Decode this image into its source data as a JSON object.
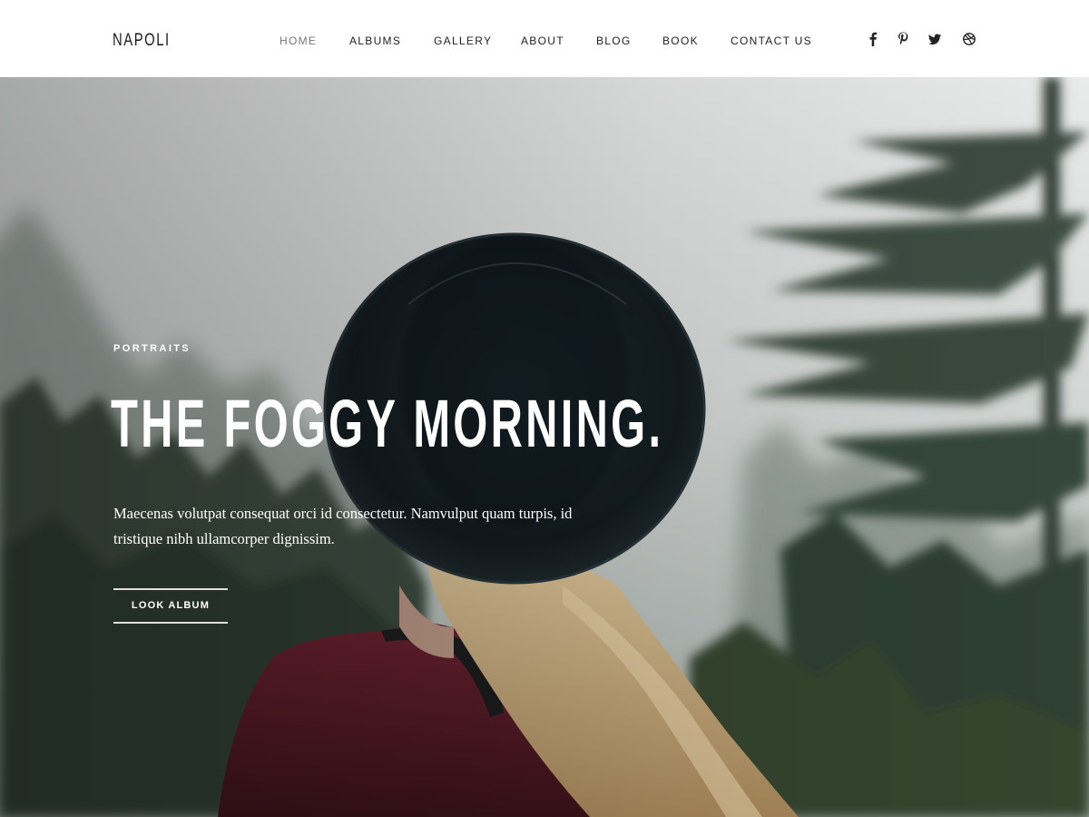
{
  "site": {
    "logo": "NAPOLI"
  },
  "nav": {
    "items": [
      {
        "label": "HOME",
        "active": true
      },
      {
        "label": "ALBUMS",
        "active": false
      },
      {
        "label": "GALLERY",
        "active": false
      },
      {
        "label": "ABOUT",
        "active": false
      },
      {
        "label": "BLOG",
        "active": false
      },
      {
        "label": "BOOK",
        "active": false
      },
      {
        "label": "CONTACT US",
        "active": false
      }
    ]
  },
  "social": [
    {
      "icon": "facebook-icon"
    },
    {
      "icon": "pinterest-icon"
    },
    {
      "icon": "twitter-icon"
    },
    {
      "icon": "dribbble-icon"
    }
  ],
  "hero": {
    "category": "PORTRAITS",
    "title": "THE FOGGY MORNING.",
    "description": "Maecenas volutpat consequat orci id consectetur. Namvulput quam turpis, id tristique nibh ullamcorper dignissim.",
    "button_label": "LOOK ALBUM",
    "image": "photo of a woman with long blonde hair wearing a black hat, seen from behind, in a foggy pine forest"
  },
  "colors": {
    "text_dark": "#222222",
    "nav_active": "#777777",
    "hero_text": "#ffffff"
  }
}
